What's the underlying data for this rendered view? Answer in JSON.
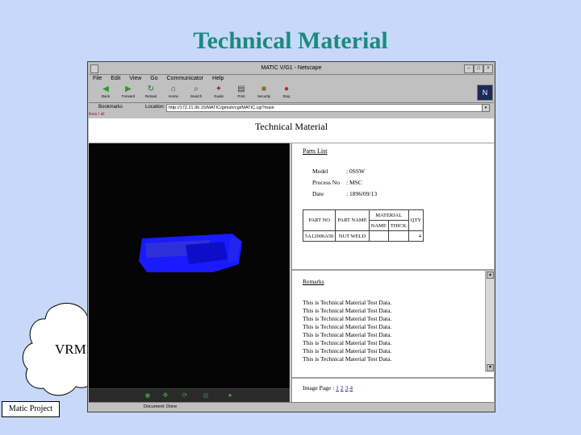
{
  "slide": {
    "title": "Technical Material",
    "cloud_label": "VRM",
    "footer_label": "Matic Project"
  },
  "window": {
    "title": "MATIC V/G1 - Netscape",
    "controls": [
      "–",
      "□",
      "×"
    ],
    "menu": [
      "File",
      "Edit",
      "View",
      "Go",
      "Communicator",
      "Help"
    ],
    "toolbar": [
      {
        "label": "Back",
        "icon": "back-arrow-icon"
      },
      {
        "label": "Forward",
        "icon": "forward-arrow-icon"
      },
      {
        "label": "Reload",
        "icon": "reload-icon"
      },
      {
        "label": "Home",
        "icon": "home-icon"
      },
      {
        "label": "Search",
        "icon": "search-icon"
      },
      {
        "label": "Guide",
        "icon": "guide-icon"
      },
      {
        "label": "Print",
        "icon": "print-icon"
      },
      {
        "label": "Security",
        "icon": "security-lock-icon"
      },
      {
        "label": "Stop",
        "icon": "stop-icon"
      }
    ],
    "bookmarks_label": "Bookmarks",
    "location_label": "Location:",
    "location_url": "http://172.21.96.15/MATIC/gimsh/cgi/MATIC.cgi?main",
    "breadcrumb": "lines / all",
    "status_text": "Document: Done"
  },
  "page": {
    "header": "Technical Material",
    "parts_title": "Parts List",
    "info": [
      {
        "key": "Model",
        "value": ": 0SSW"
      },
      {
        "key": "Process No",
        "value": ": MSC"
      },
      {
        "key": "Date",
        "value": ": 1896/09/13"
      }
    ],
    "table": {
      "headers": [
        "PART NO",
        "PART NAME",
        "MATERIAL",
        "QTY"
      ],
      "material_sub": [
        "NAME",
        "THICK"
      ],
      "rows": [
        [
          "5A12000A50",
          "NUT WELD",
          "",
          "",
          "4"
        ]
      ]
    },
    "notes_title": "Remarks",
    "notes_lines": [
      "This is Technical Material Test Data.",
      "This is Technical Material Test Data.",
      "This is Technical Material Test Data.",
      "This is Technical Material Test Data.",
      "This is Technical Material Test Data.",
      "This is Technical Material Test Data.",
      "This is Technical Material Test Data.",
      "This is Technical Material Test Data."
    ],
    "pager_label": "Image Page",
    "pages": [
      "1",
      "2",
      "3",
      "4"
    ]
  },
  "colors": {
    "slide_background": "#c8d8f8",
    "title_teal": "#1a8a80",
    "vrml_background": "#050505",
    "model_blue": "#1a1aff"
  }
}
